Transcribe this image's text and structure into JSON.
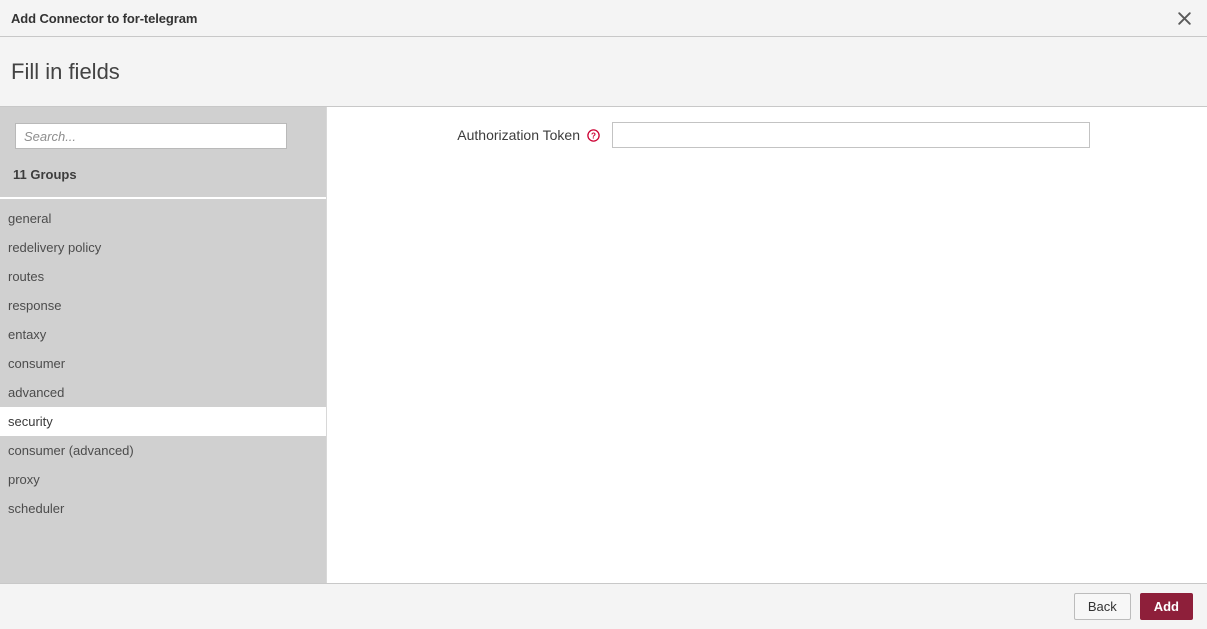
{
  "titlebar": {
    "title": "Add Connector to for-telegram",
    "close_label": "✕"
  },
  "step": {
    "heading": "Fill in fields"
  },
  "sidebar": {
    "search_placeholder": "Search...",
    "search_value": "",
    "group_count_label": "11 Groups",
    "items": [
      {
        "label": "general",
        "selected": false
      },
      {
        "label": "redelivery policy",
        "selected": false
      },
      {
        "label": "routes",
        "selected": false
      },
      {
        "label": "response",
        "selected": false
      },
      {
        "label": "entaxy",
        "selected": false
      },
      {
        "label": "consumer",
        "selected": false
      },
      {
        "label": "advanced",
        "selected": false
      },
      {
        "label": "security",
        "selected": true
      },
      {
        "label": "consumer (advanced)",
        "selected": false
      },
      {
        "label": "proxy",
        "selected": false
      },
      {
        "label": "scheduler",
        "selected": false
      }
    ]
  },
  "form": {
    "fields": [
      {
        "label": "Authorization Token",
        "help_icon": "help-circle-icon",
        "value": "",
        "placeholder": ""
      }
    ]
  },
  "footer": {
    "back_label": "Back",
    "add_label": "Add"
  },
  "colors": {
    "accent": "#8e1f3a",
    "help_icon": "#cc0033",
    "sidebar_bg": "#d0d0d0",
    "chrome_bg": "#f4f4f4"
  }
}
